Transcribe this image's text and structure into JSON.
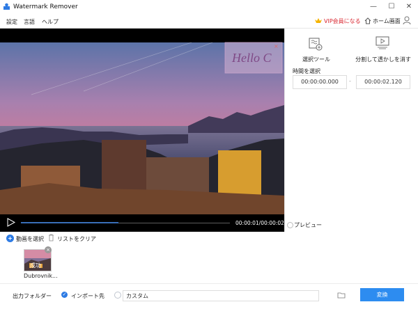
{
  "window": {
    "title": "Watermark Remover",
    "minimize": "—",
    "maximize": "☐",
    "close": "✕"
  },
  "menu": {
    "settings": "設定",
    "language": "言語",
    "help": "ヘルプ",
    "vip": "VIP会員になる",
    "home": "ホーム画面"
  },
  "video": {
    "watermark_text": "Hello C",
    "time_display": "00:00:01/00:00:02"
  },
  "tools": {
    "select_tool": "選択ツール",
    "split_tool": "分割して透かしを消す",
    "time_select": "時間を選択",
    "start_time": "00:00:00.000",
    "end_time": "00:00:02.120"
  },
  "preview": {
    "label": "プレビュー"
  },
  "filebar": {
    "select_video": "動画を選択",
    "clear_list": "リストをクリア"
  },
  "thumbnail": {
    "status": "成功",
    "filename": "Dubrovnik..."
  },
  "bottom": {
    "output_folder": "出力フォルダー",
    "import_dest": "インポート先",
    "custom": "カスタム",
    "convert": "変換"
  },
  "colors": {
    "accent": "#2d8cf0",
    "vip": "#d9252e"
  }
}
